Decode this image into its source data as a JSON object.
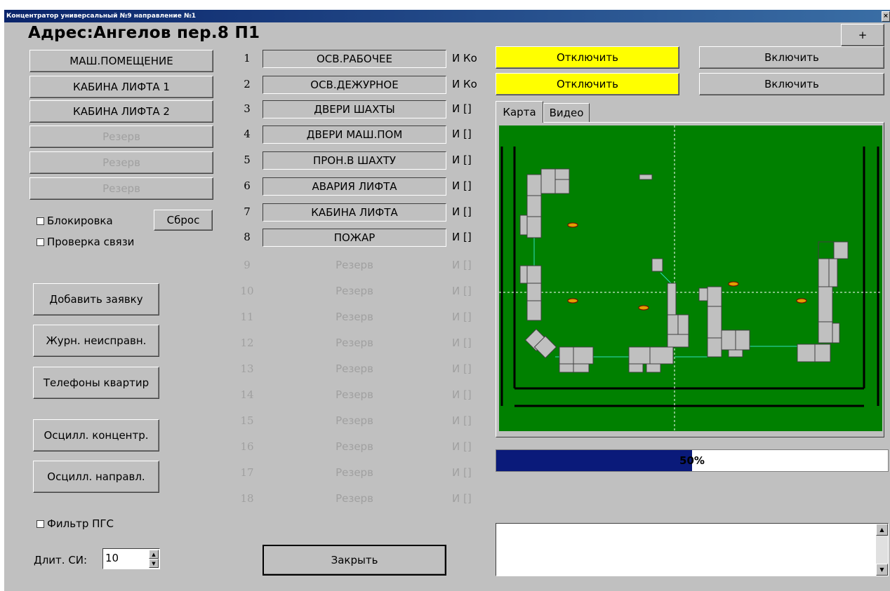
{
  "window": {
    "title": "Концентратор универсальный №9 направление №1",
    "address": "Адрес:Ангелов пер.8 П1"
  },
  "left_buttons": [
    {
      "label": "МАШ.ПОМЕЩЕНИЕ",
      "enabled": true
    },
    {
      "label": "КАБИНА ЛИФТА 1",
      "enabled": true
    },
    {
      "label": "КАБИНА ЛИФТА 2",
      "enabled": true
    },
    {
      "label": "Резерв",
      "enabled": false
    },
    {
      "label": "Резерв",
      "enabled": false
    },
    {
      "label": "Резерв",
      "enabled": false
    }
  ],
  "options": {
    "block_label": "Блокировка",
    "reset_label": "Сброс",
    "check_link_label": "Проверка связи",
    "filter_label": "Фильтр ПГС"
  },
  "actions": {
    "add_request": "Добавить заявку",
    "fault_log": "Журн. неисправн.",
    "phones": "Телефоны квартир",
    "osc_conc": "Осцилл. концентр.",
    "osc_dir": "Осцилл. направл."
  },
  "duration": {
    "label": "Длит. СИ:",
    "value": "10"
  },
  "channels": [
    {
      "num": "1",
      "label": "ОСВ.РАБОЧЕЕ",
      "ind": "И Ко",
      "enabled": true
    },
    {
      "num": "2",
      "label": "ОСВ.ДЕЖУРНОЕ",
      "ind": "И Ко",
      "enabled": true
    },
    {
      "num": "3",
      "label": "ДВЕРИ ШАХТЫ",
      "ind": "И []",
      "enabled": true
    },
    {
      "num": "4",
      "label": "ДВЕРИ МАШ.ПОМ",
      "ind": "И []",
      "enabled": true
    },
    {
      "num": "5",
      "label": "ПРОН.В ШАХТУ",
      "ind": "И []",
      "enabled": true
    },
    {
      "num": "6",
      "label": "АВАРИЯ ЛИФТА",
      "ind": "И []",
      "enabled": true
    },
    {
      "num": "7",
      "label": "КАБИНА ЛИФТА",
      "ind": "И []",
      "enabled": true
    },
    {
      "num": "8",
      "label": "ПОЖАР",
      "ind": "И []",
      "enabled": true
    },
    {
      "num": "9",
      "label": "Резерв",
      "ind": "И []",
      "enabled": false
    },
    {
      "num": "10",
      "label": "Резерв",
      "ind": "И []",
      "enabled": false
    },
    {
      "num": "11",
      "label": "Резерв",
      "ind": "И []",
      "enabled": false
    },
    {
      "num": "12",
      "label": "Резерв",
      "ind": "И []",
      "enabled": false
    },
    {
      "num": "13",
      "label": "Резерв",
      "ind": "И []",
      "enabled": false
    },
    {
      "num": "14",
      "label": "Резерв",
      "ind": "И []",
      "enabled": false
    },
    {
      "num": "15",
      "label": "Резерв",
      "ind": "И []",
      "enabled": false
    },
    {
      "num": "16",
      "label": "Резерв",
      "ind": "И []",
      "enabled": false
    },
    {
      "num": "17",
      "label": "Резерв",
      "ind": "И []",
      "enabled": false
    },
    {
      "num": "18",
      "label": "Резерв",
      "ind": "И []",
      "enabled": false
    }
  ],
  "close_label": "Закрыть",
  "plus_label": "+",
  "controls": [
    {
      "off_label": "Отключить",
      "on_label": "Включить"
    },
    {
      "off_label": "Отключить",
      "on_label": "Включить"
    }
  ],
  "tabs": [
    "Карта",
    "Видео"
  ],
  "progress": {
    "value": 50,
    "text": "50%"
  },
  "colors": {
    "map_bg": "#008000",
    "highlight": "#ffff00",
    "progress": "#0a1a7a",
    "window_bg": "#c0c0c0"
  }
}
